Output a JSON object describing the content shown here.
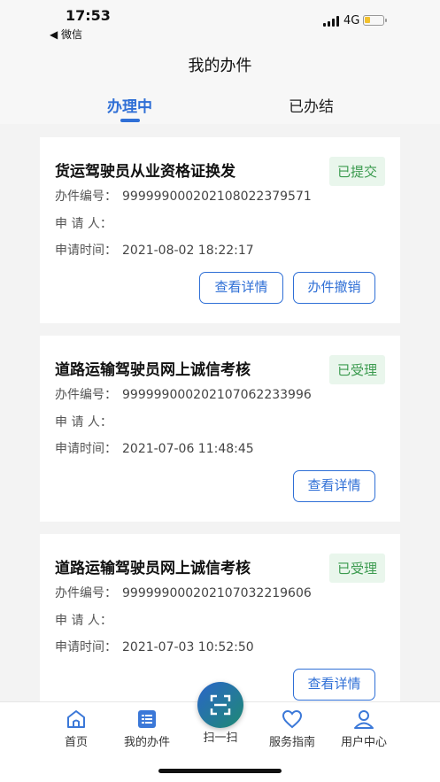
{
  "status_bar": {
    "time": "17:53",
    "back_app": "◀ 微信",
    "network": "4G"
  },
  "nav": {
    "title": "我的办件"
  },
  "tabs": [
    {
      "label": "办理中"
    },
    {
      "label": "已办结"
    }
  ],
  "cards": [
    {
      "title": "货运驾驶员从业资格证换发",
      "status": "已提交",
      "fields": [
        {
          "label": "办件编号：",
          "value": "99999900020210802237957​1"
        },
        {
          "label": "申 请 人：",
          "value": ""
        },
        {
          "label": "申请时间：",
          "value": "2021-08-02 18:22:17"
        }
      ],
      "buttons": [
        "查看详情",
        "办件撤销"
      ]
    },
    {
      "title": "道路运输驾驶员网上诚信考核",
      "status": "已受理",
      "fields": [
        {
          "label": "办件编号：",
          "value": "999999000202107062233996"
        },
        {
          "label": "申 请 人：",
          "value": ""
        },
        {
          "label": "申请时间：",
          "value": "2021-07-06 11:48:45"
        }
      ],
      "buttons": [
        "查看详情"
      ]
    },
    {
      "title": "道路运输驾驶员网上诚信考核",
      "status": "已受理",
      "fields": [
        {
          "label": "办件编号：",
          "value": "999999000202107032219606"
        },
        {
          "label": "申 请 人：",
          "value": ""
        },
        {
          "label": "申请时间：",
          "value": "2021-07-03 10:52:50"
        }
      ],
      "buttons": [
        "查看详情"
      ]
    }
  ],
  "tabbar": [
    {
      "label": "首页",
      "icon": "home-icon"
    },
    {
      "label": "我的办件",
      "icon": "list-icon"
    },
    {
      "label": "扫一扫",
      "icon": "scan-icon"
    },
    {
      "label": "服务指南",
      "icon": "heart-icon"
    },
    {
      "label": "用户中心",
      "icon": "user-icon"
    }
  ],
  "colors": {
    "accent": "#2f6fd6",
    "status_green": "#3a9a4e",
    "status_green_bg": "#e9f6ec"
  }
}
